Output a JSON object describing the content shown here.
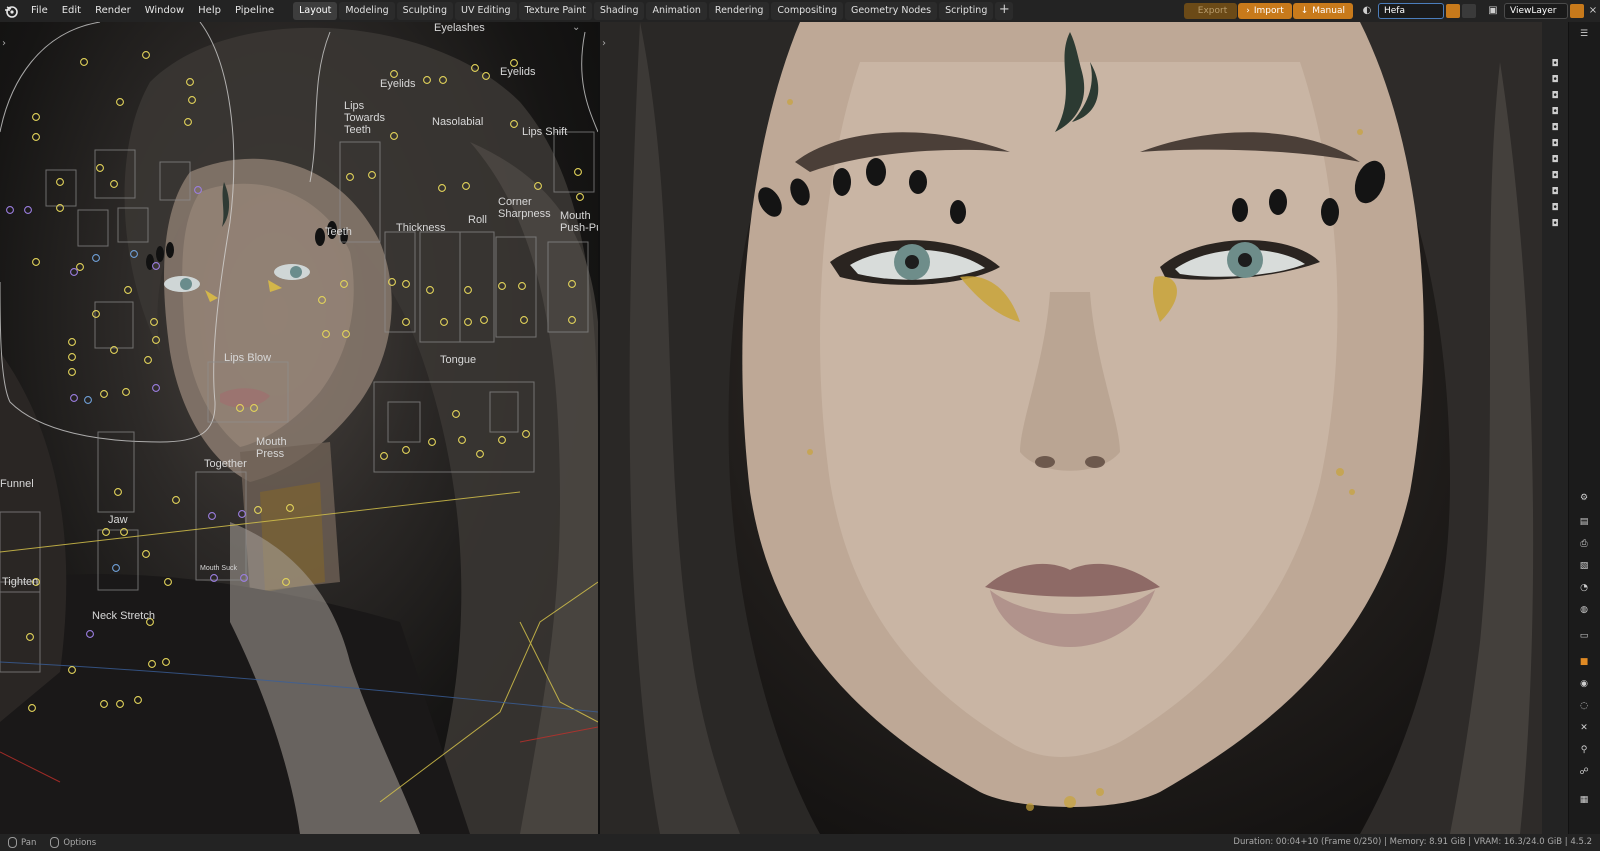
{
  "menu": [
    "File",
    "Edit",
    "Render",
    "Window",
    "Help",
    "Pipeline"
  ],
  "workspaces": [
    "Layout",
    "Modeling",
    "Sculpting",
    "UV Editing",
    "Texture Paint",
    "Shading",
    "Animation",
    "Rendering",
    "Compositing",
    "Geometry Nodes",
    "Scripting"
  ],
  "active_workspace": "Layout",
  "add_workspace": "+",
  "pipeline": {
    "export": "Export",
    "import": "Import",
    "manual": "Manual"
  },
  "scene_field": "Hefa",
  "view_layer": "ViewLayer",
  "rig_labels": [
    "Eyelashes",
    "Eyelids",
    "Eyelids",
    "Lips Towards Teeth",
    "Nasolabial",
    "Lips Shift",
    "Teeth",
    "Thickness",
    "Roll",
    "Corner Sharpness",
    "Mouth Push-Pu",
    "Tongue",
    "Lips Blow",
    "Mouth Press",
    "Together",
    "Funnel",
    "Jaw",
    "Mouth Suck",
    "Tighten",
    "Neck Stretch"
  ],
  "status": {
    "pan": "Pan",
    "options": "Options",
    "info": "Duration: 00:04+10 (Frame 0/250) | Memory: 8.91 GiB | VRAM: 16.3/24.0 GiB | 4.5.2"
  },
  "colors": {
    "accent": "#c87a1b",
    "active_field": "#4b7dbb",
    "rig_yellow": "#e2d35a",
    "rig_purple": "#9b7ee0"
  }
}
